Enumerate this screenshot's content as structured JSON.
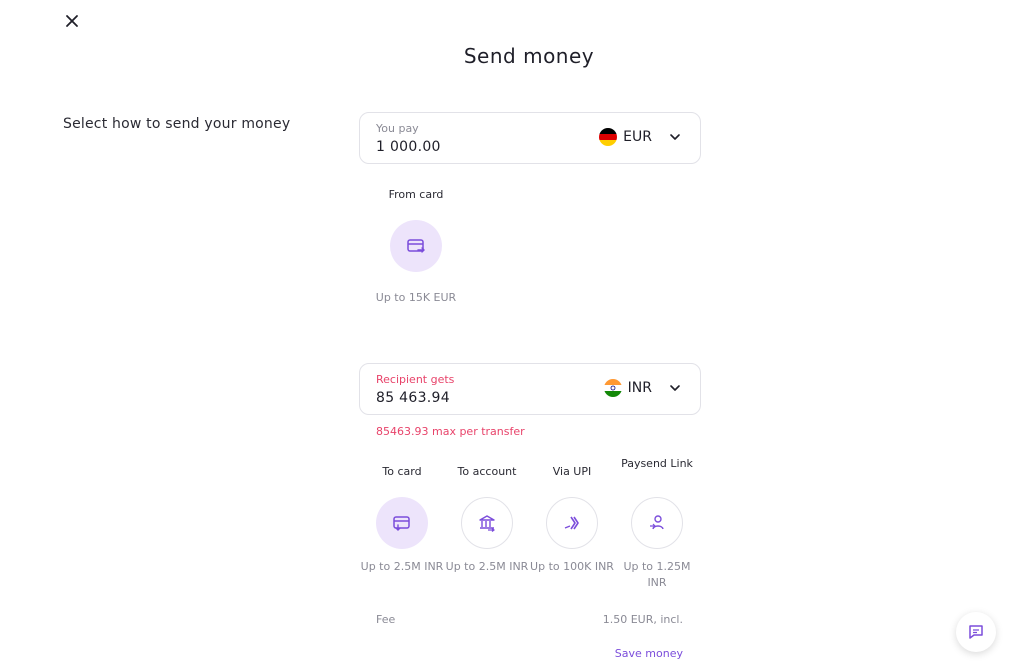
{
  "header": {
    "title": "Send money"
  },
  "subtitle": "Select how to send your money",
  "you_pay": {
    "label": "You pay",
    "amount": "1 000.00",
    "currency": "EUR"
  },
  "from_methods": [
    {
      "title": "From card",
      "limit": "Up to 15K EUR",
      "selected": true,
      "icon": "card-out-icon"
    }
  ],
  "recipient_gets": {
    "label": "Recipient gets",
    "amount": "85 463.94",
    "currency": "INR",
    "note": "85463.93 max per transfer"
  },
  "to_methods": [
    {
      "title": "To card",
      "limit": "Up to 2.5M INR",
      "selected": true,
      "icon": "card-in-icon"
    },
    {
      "title": "To account",
      "limit": "Up to 2.5M INR",
      "selected": false,
      "icon": "bank-icon"
    },
    {
      "title": "Via UPI",
      "limit": "Up to 100K INR",
      "selected": false,
      "icon": "upi-icon"
    },
    {
      "title": "Paysend Link",
      "limit": "Up to 1.25M INR",
      "selected": false,
      "icon": "link-person-icon"
    }
  ],
  "fee": {
    "label": "Fee",
    "value": "1.50 EUR, incl."
  },
  "save_money": "Save money",
  "colors": {
    "accent": "#7b4ddb",
    "selected_bg": "#ede4fb",
    "error": "#e8436a"
  }
}
